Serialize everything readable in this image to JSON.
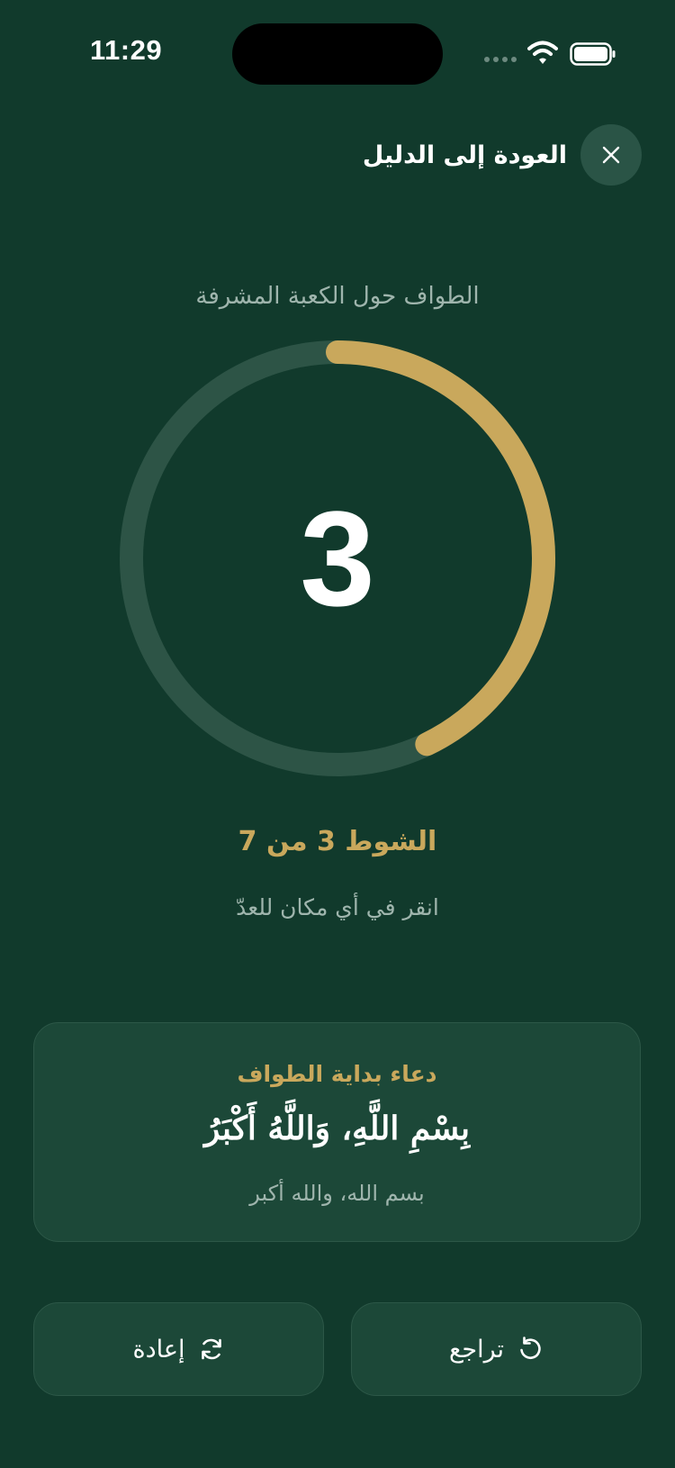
{
  "status_bar": {
    "time": "11:29",
    "icons": [
      "cellular-signal-icon",
      "wifi-icon",
      "battery-icon"
    ]
  },
  "header": {
    "close_icon": "close-icon",
    "back_label": "العودة إلى الدليل"
  },
  "counter": {
    "title": "الطواف حول الكعبة المشرفة",
    "count": "3",
    "progress_fraction": 0.4286,
    "round_label": "الشوط 3 من 7",
    "tap_hint": "انقر في أي مكان للعدّ"
  },
  "dua": {
    "title": "دعاء بداية الطواف",
    "arabic": "بِسْمِ اللَّهِ، وَاللَّهُ أَكْبَرُ",
    "plain": "بسم الله، والله أكبر"
  },
  "actions": {
    "undo_label": "تراجع",
    "undo_icon": "undo-icon",
    "reset_label": "إعادة",
    "reset_icon": "refresh-icon"
  },
  "colors": {
    "background": "#113a2c",
    "accent_gold": "#c9a85c",
    "ring_track": "#2d5446",
    "card": "#1c4838",
    "muted_text": "#9fb5ad"
  }
}
